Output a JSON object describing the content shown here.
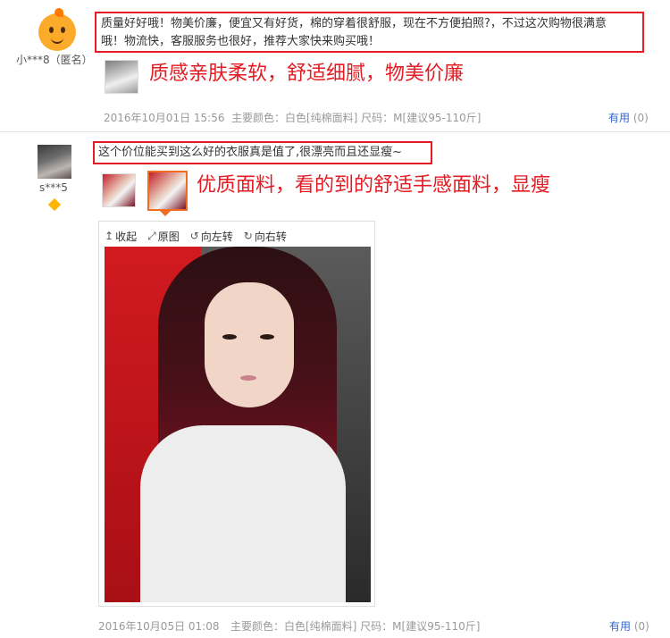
{
  "reviews": [
    {
      "username": "小***8（匿名）",
      "text_line1": "质量好好哦！物美价廉，便宜又有好货，棉的穿着很舒服，现在不方便拍照?，不过这次购物很满意",
      "text_line2": "哦！物流快，客服服务也很好，推荐大家快来购买哦！",
      "annotation": "质感亲肤柔软，舒适细腻，物美价廉",
      "date": "2016年10月01日 15:56",
      "attrs": "主要颜色：白色[纯棉面料]  尺码：M[建议95-110斤]",
      "useful_label": "有用",
      "useful_count": "(0)"
    },
    {
      "username": "s***5",
      "text": "这个价位能买到这么好的衣服真是值了,很漂亮而且还显瘦~",
      "annotation": "优质面料，看的到的舒适手感面料，显瘦",
      "viewer_toolbar": [
        "收起",
        "原图",
        "向左转",
        "向右转"
      ],
      "date": "2016年10月05日 01:08",
      "attrs": "主要颜色：白色[纯棉面料]  尺码：M[建议95-110斤]",
      "useful_label": "有用",
      "useful_count": "(0)"
    }
  ],
  "colors": {
    "highlight_red": "#e31b23",
    "link_blue": "#3366cc",
    "selected_thumb": "#f26c22"
  },
  "icons": [
    "collapse-arrow-icon",
    "fullsize-icon",
    "rotate-left-icon",
    "rotate-right-icon",
    "vip-diamond-icon"
  ]
}
